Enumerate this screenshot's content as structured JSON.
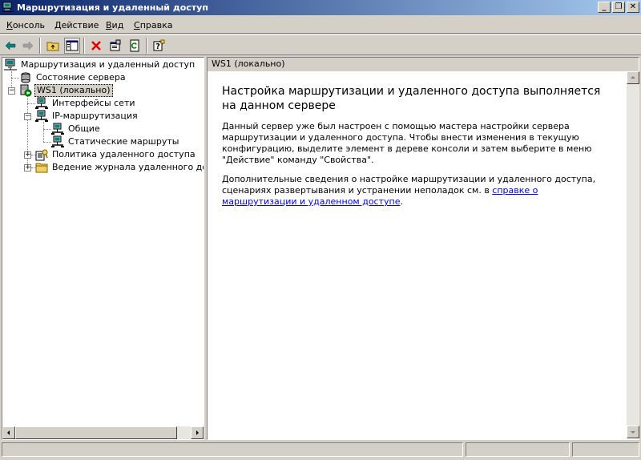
{
  "window": {
    "title": "Маршрутизация и удаленный доступ",
    "buttons": {
      "minimize": "_",
      "restore": "❐",
      "close": "✕"
    }
  },
  "menu": [
    "Консоль",
    "Действие",
    "Вид",
    "Справка"
  ],
  "toolbar": {
    "icons": [
      "back-icon",
      "forward-icon",
      "up-folder-icon",
      "show-hide-tree-icon",
      "delete-icon",
      "properties-icon",
      "refresh-icon",
      "help-icon"
    ]
  },
  "tree": {
    "root": "Маршрутизация и удаленный доступ",
    "server_status": "Состояние сервера",
    "server": "WS1 (локально)",
    "interfaces": "Интерфейсы сети",
    "ip_routing": "IP-маршрутизация",
    "general": "Общие",
    "static_routes": "Статические маршруты",
    "remote_access_policy": "Политика удаленного доступа",
    "remote_access_logging": "Ведение журнала удаленного доступа"
  },
  "content": {
    "header": "WS1 (локально)",
    "title": "Настройка маршрутизации и удаленного доступа выполняется на данном сервере",
    "paragraph1": "Данный сервер уже был настроен с помощью мастера настройки сервера маршрутизации и удаленного доступа. Чтобы внести изменения в текущую конфигурацию, выделите элемент в дереве консоли и затем выберите в меню \"Действие\" команду \"Свойства\".",
    "paragraph2_prefix": "Дополнительные сведения о настройке маршрутизации и удаленного доступа, сценариях развертывания и устранении неполадок см. в ",
    "paragraph2_link": "справке о маршрутизации и удаленном доступе",
    "paragraph2_suffix": "."
  },
  "colors": {
    "title_gradient_start": "#0a246a",
    "title_gradient_end": "#a6caf0",
    "window_bg": "#d4d0c8",
    "link": "#0000ee"
  }
}
